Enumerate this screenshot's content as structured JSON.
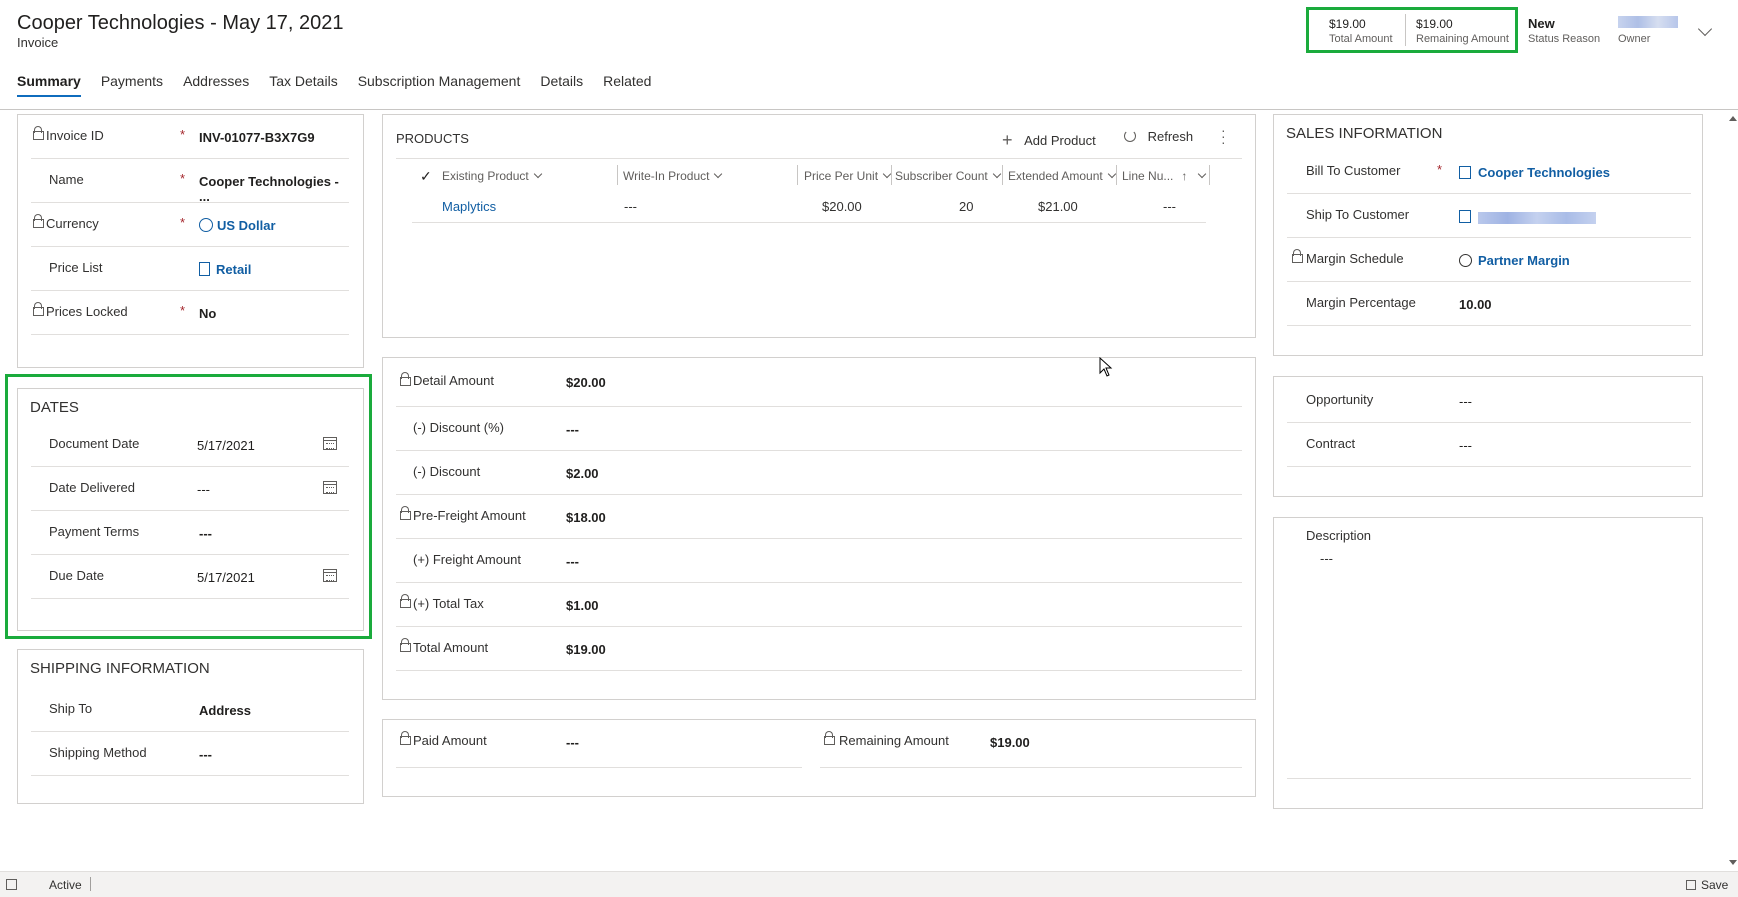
{
  "header": {
    "title": "Cooper Technologies - May 17, 2021",
    "subtitle": "Invoice",
    "total_amount": "$19.00",
    "total_amount_label": "Total Amount",
    "remaining_amount": "$19.00",
    "remaining_amount_label": "Remaining Amount",
    "status_reason": "New",
    "status_reason_label": "Status Reason",
    "owner_label": "Owner"
  },
  "tabs": [
    "Summary",
    "Payments",
    "Addresses",
    "Tax Details",
    "Subscription Management",
    "Details",
    "Related"
  ],
  "general": {
    "invoice_id_label": "Invoice ID",
    "invoice_id": "INV-01077-B3X7G9",
    "name_label": "Name",
    "name": "Cooper Technologies - ...",
    "currency_label": "Currency",
    "currency": "US Dollar",
    "price_list_label": "Price List",
    "price_list": "Retail",
    "prices_locked_label": "Prices Locked",
    "prices_locked": "No",
    "required_marker": "*"
  },
  "dates": {
    "title": "DATES",
    "document_date_label": "Document Date",
    "document_date": "5/17/2021",
    "date_delivered_label": "Date Delivered",
    "date_delivered": "---",
    "payment_terms_label": "Payment Terms",
    "payment_terms": "---",
    "due_date_label": "Due Date",
    "due_date": "5/17/2021"
  },
  "shipping": {
    "title": "SHIPPING INFORMATION",
    "ship_to_label": "Ship To",
    "ship_to": "Address",
    "shipping_method_label": "Shipping Method",
    "shipping_method": "---"
  },
  "products": {
    "title": "PRODUCTS",
    "add_product": "Add Product",
    "refresh": "Refresh",
    "columns": [
      "Existing Product",
      "Write-In Product",
      "Price Per Unit",
      "Subscriber Count",
      "Extended Amount",
      "Line Nu..."
    ],
    "rows": [
      {
        "existing_product": "Maplytics",
        "write_in": "---",
        "price_per_unit": "$20.00",
        "subscriber_count": "20",
        "extended_amount": "$21.00",
        "line_number": "---"
      }
    ]
  },
  "amounts": {
    "detail_amount_label": "Detail Amount",
    "detail_amount": "$20.00",
    "discount_pct_label": "(-) Discount (%)",
    "discount_pct": "---",
    "discount_label": "(-) Discount",
    "discount": "$2.00",
    "pre_freight_label": "Pre-Freight Amount",
    "pre_freight": "$18.00",
    "freight_label": "(+) Freight Amount",
    "freight": "---",
    "total_tax_label": "(+) Total Tax",
    "total_tax": "$1.00",
    "total_amount_label": "Total Amount",
    "total_amount": "$19.00"
  },
  "payment": {
    "paid_amount_label": "Paid Amount",
    "paid_amount": "---",
    "remaining_amount_label": "Remaining Amount",
    "remaining_amount": "$19.00"
  },
  "sales": {
    "title": "SALES INFORMATION",
    "bill_to_label": "Bill To Customer",
    "bill_to": "Cooper Technologies",
    "ship_to_customer_label": "Ship To Customer",
    "margin_schedule_label": "Margin Schedule",
    "margin_schedule": "Partner Margin",
    "margin_percentage_label": "Margin Percentage",
    "margin_percentage": "10.00"
  },
  "related": {
    "opportunity_label": "Opportunity",
    "opportunity": "---",
    "contract_label": "Contract",
    "contract": "---"
  },
  "description": {
    "label": "Description",
    "value": "---"
  },
  "statusbar": {
    "status": "Active",
    "save": "Save"
  },
  "colors": {
    "highlight": "#1aab3c",
    "link": "#115ea3",
    "required": "#a4262c"
  }
}
